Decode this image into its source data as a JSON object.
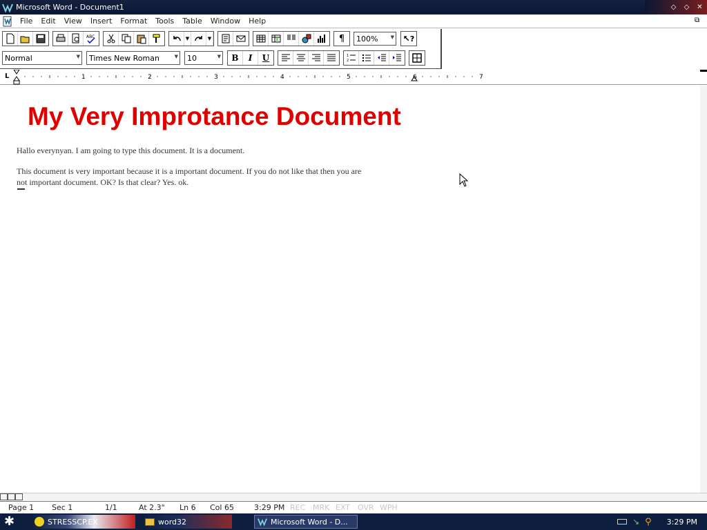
{
  "window": {
    "title": "Microsoft Word - Document1"
  },
  "menu": {
    "items": [
      "File",
      "Edit",
      "View",
      "Insert",
      "Format",
      "Tools",
      "Table",
      "Window",
      "Help"
    ]
  },
  "toolbar": {
    "zoom": "100%",
    "style": "Normal",
    "font": "Times New Roman",
    "size": "10",
    "bold": "B",
    "italic": "I",
    "underline": "U",
    "pilcrow": "¶",
    "help": "?"
  },
  "ruler": {
    "numbers": [
      "1",
      "2",
      "3",
      "4",
      "5",
      "6",
      "7"
    ],
    "tab_marker": "L"
  },
  "document": {
    "title": "My Very Improtance Document",
    "paragraph1": "Hallo everynyan. I am going to type this document. It is a document.",
    "paragraph2": "This document is very important because it is a important document. If you do not like that then you are not important document. OK? Is that clear? Yes. ok."
  },
  "statusbar": {
    "page": "Page 1",
    "sec": "Sec 1",
    "pages": "1/1",
    "at": "At 2.3\"",
    "ln": "Ln 6",
    "col": "Col 65",
    "time": "3:29 PM",
    "rec": "REC",
    "mrk": "MRK",
    "ext": "EXT",
    "ovr": "OVR",
    "wph": "WPH"
  },
  "taskbar": {
    "tasks": [
      "STRESSCP.EX",
      "word32",
      "Microsoft Word - D..."
    ],
    "clock": "3:29 PM"
  },
  "colors": {
    "title_red": "#e00000",
    "titlebar": "#15223f",
    "taskbar": "#0e1e3e"
  }
}
